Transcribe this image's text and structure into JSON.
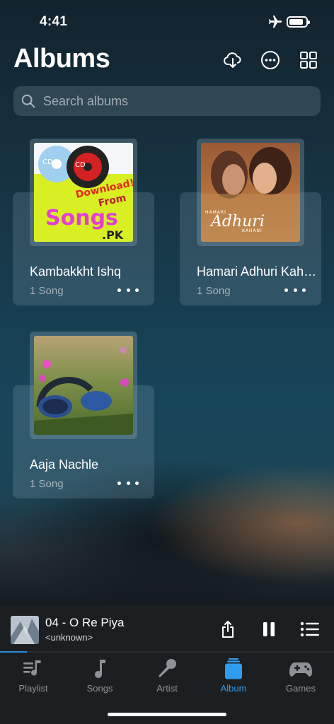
{
  "status": {
    "time": "4:41"
  },
  "header": {
    "title": "Albums"
  },
  "search": {
    "placeholder": "Search albums"
  },
  "albums": [
    {
      "name": "Kambakkht Ishq",
      "count": "1 Song",
      "art_text": {
        "cd1": "CD",
        "cd2": "CD",
        "dl1": "Download!",
        "dl2": "From",
        "songs": "Songs",
        "pk": ".PK"
      }
    },
    {
      "name": "Hamari Adhuri Kahaani",
      "count": "1 Song",
      "art_text": {
        "small": "HAMARI",
        "script": "Adhuri",
        "sub": "KAHANI"
      }
    },
    {
      "name": "Aaja Nachle",
      "count": "1 Song"
    }
  ],
  "now_playing": {
    "title": "04 - O Re Piya",
    "artist": "<unknown>",
    "progress": 0.08
  },
  "tabs": [
    {
      "label": "Playlist",
      "icon": "playlist-icon",
      "active": false
    },
    {
      "label": "Songs",
      "icon": "music-note-icon",
      "active": false
    },
    {
      "label": "Artist",
      "icon": "microphone-icon",
      "active": false
    },
    {
      "label": "Album",
      "icon": "album-icon",
      "active": true
    },
    {
      "label": "Games",
      "icon": "gamepad-icon",
      "active": false
    }
  ],
  "colors": {
    "accent": "#2f9cf0",
    "bar_bg": "#1c1f22",
    "inactive": "#8e9296"
  }
}
